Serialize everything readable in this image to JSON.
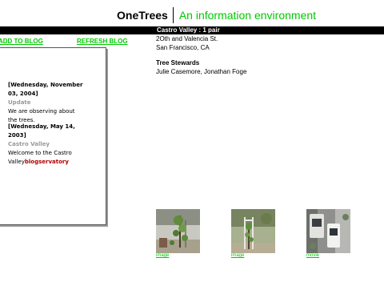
{
  "header": {
    "brand": "OneTrees",
    "tagline": "An information environment"
  },
  "site": {
    "title": "Castro Valley : 1 pair",
    "address_line1": "2Oth and Valencia St.",
    "address_line2": "San Francisco, CA",
    "stewards_label": "Tree Stewards",
    "stewards": "Julie Casemore, Jonathan Foge"
  },
  "blog": {
    "add_label": "ADD TO BLOG",
    "refresh_label": "REFRESH BLOG",
    "entries": [
      {
        "date_line1": "[Wednesday, November",
        "date_line2": "03, 2004]",
        "category": "Update",
        "body_line1": "We are observing about",
        "body_line2": "the trees."
      },
      {
        "date_line1": "[Wednesday, May 14,",
        "date_line2": "2003]",
        "category": "Castro Valley",
        "body_line1": "Welcome to the Castro",
        "body_line2a": "Valley",
        "body_line2b": "blogservatory"
      }
    ]
  },
  "media": [
    {
      "caption": "image",
      "icon": "tree-photo"
    },
    {
      "caption": "image",
      "icon": "tree-photo"
    },
    {
      "caption": "movie",
      "icon": "street-aerial-photo"
    }
  ],
  "colors": {
    "accent_green": "#00c800",
    "highlight_red": "#b00000",
    "bar_black": "#000000"
  }
}
